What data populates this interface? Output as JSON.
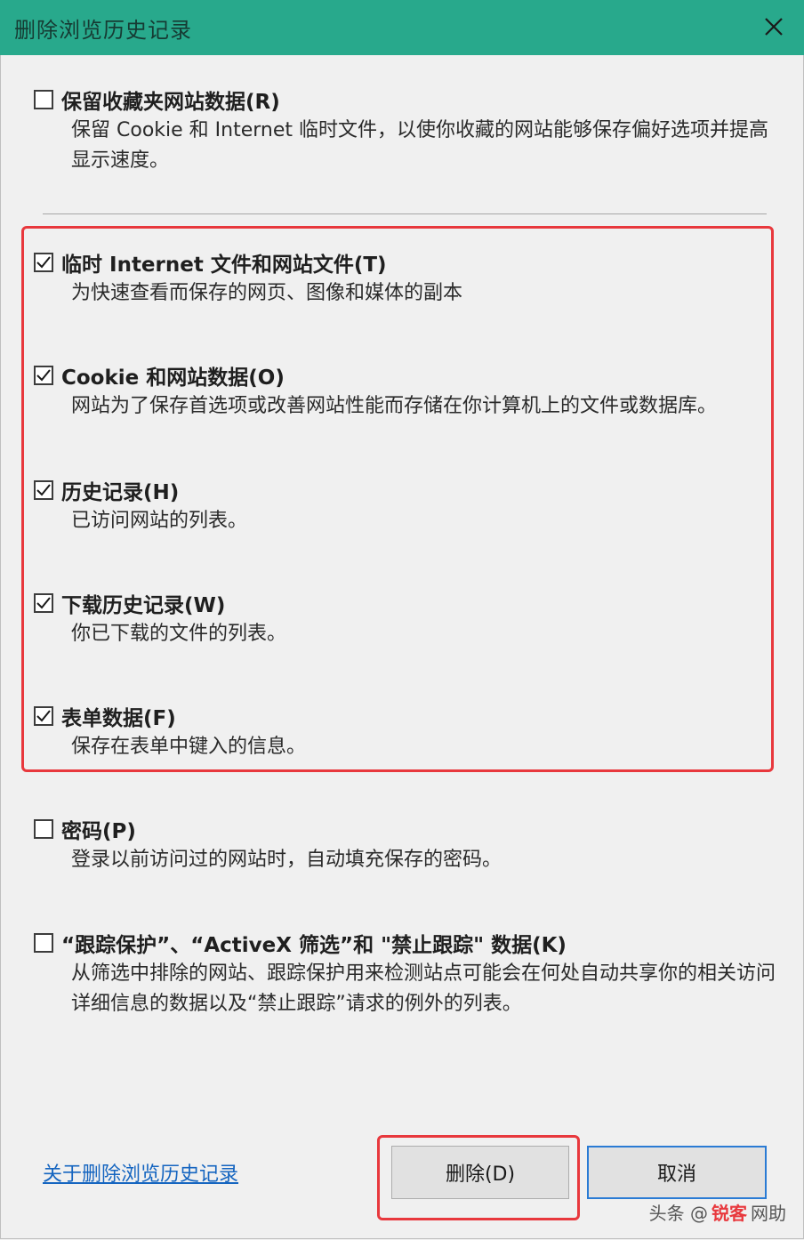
{
  "window": {
    "title": "删除浏览历史记录",
    "close_icon": "close-icon",
    "accent_color": "#28a98c"
  },
  "options": [
    {
      "key": "favorites",
      "label": "保留收藏夹网站数据(R)",
      "checked": false,
      "description": "保留 Cookie 和 Internet 临时文件，以使你收藏的网站能够保存偏好选项并提高显示速度。"
    },
    {
      "key": "temp_files",
      "label": "临时 Internet 文件和网站文件(T)",
      "checked": true,
      "description": "为快速查看而保存的网页、图像和媒体的副本"
    },
    {
      "key": "cookies",
      "label": "Cookie 和网站数据(O)",
      "checked": true,
      "description": "网站为了保存首选项或改善网站性能而存储在你计算机上的文件或数据库。"
    },
    {
      "key": "history",
      "label": "历史记录(H)",
      "checked": true,
      "description": "已访问网站的列表。"
    },
    {
      "key": "download_history",
      "label": "下载历史记录(W)",
      "checked": true,
      "description": "你已下载的文件的列表。"
    },
    {
      "key": "form_data",
      "label": "表单数据(F)",
      "checked": true,
      "description": "保存在表单中键入的信息。"
    },
    {
      "key": "passwords",
      "label": "密码(P)",
      "checked": false,
      "description": "登录以前访问过的网站时，自动填充保存的密码。"
    },
    {
      "key": "tracking",
      "label": "“跟踪保护”、“ActiveX 筛选”和 \"禁止跟踪\" 数据(K)",
      "checked": false,
      "description": "从筛选中排除的网站、跟踪保护用来检测站点可能会在何处自动共享你的相关访问详细信息的数据以及“禁止跟踪”请求的例外的列表。"
    }
  ],
  "footer": {
    "help_link": "关于删除浏览历史记录",
    "delete_button": "删除(D)",
    "cancel_button": "取消"
  },
  "watermark": {
    "prefix": "头条 @",
    "accent": "锐客",
    "suffix": "网助"
  },
  "colors": {
    "highlight": "#e8383d",
    "link": "#1565c0",
    "default_button_border": "#2a7bd4"
  }
}
